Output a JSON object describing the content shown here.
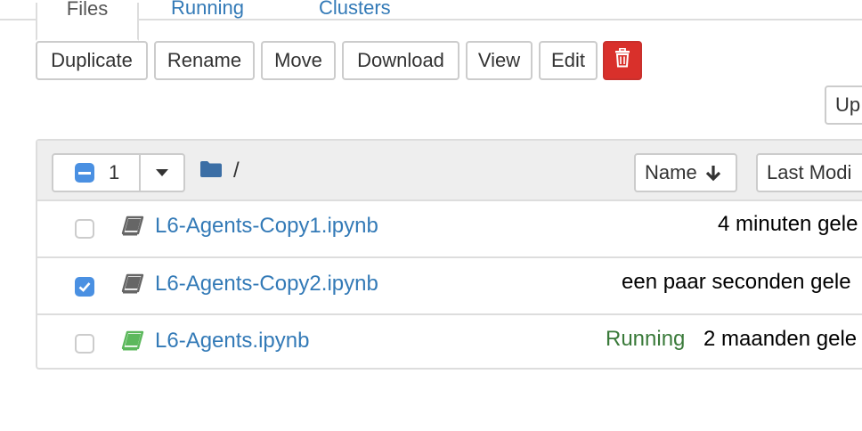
{
  "tabs": [
    {
      "label": "Files",
      "active": true
    },
    {
      "label": "Running",
      "active": false
    },
    {
      "label": "Clusters",
      "active": false
    }
  ],
  "toolbar": {
    "duplicate_label": "Duplicate",
    "rename_label": "Rename",
    "move_label": "Move",
    "download_label": "Download",
    "view_label": "View",
    "edit_label": "Edit",
    "delete_icon": "trash-icon",
    "upload_label": "Up"
  },
  "listing": {
    "selected_count": "1",
    "breadcrumb": "/",
    "sort_name_label": "Name",
    "sort_modified_label": "Last Modi",
    "files": [
      {
        "name": "L6-Agents-Copy1.ipynb",
        "status": "",
        "modified": "4 minuten gele",
        "checked": false,
        "running": false
      },
      {
        "name": "L6-Agents-Copy2.ipynb",
        "status": "",
        "modified": "een paar seconden gele",
        "checked": true,
        "running": false
      },
      {
        "name": "L6-Agents.ipynb",
        "status": "Running",
        "modified": "2 maanden gele",
        "checked": false,
        "running": true
      }
    ]
  },
  "colors": {
    "link": "#337ab7",
    "danger": "#d9302b",
    "running": "#3a7a3a",
    "accent": "#4a90e2"
  }
}
